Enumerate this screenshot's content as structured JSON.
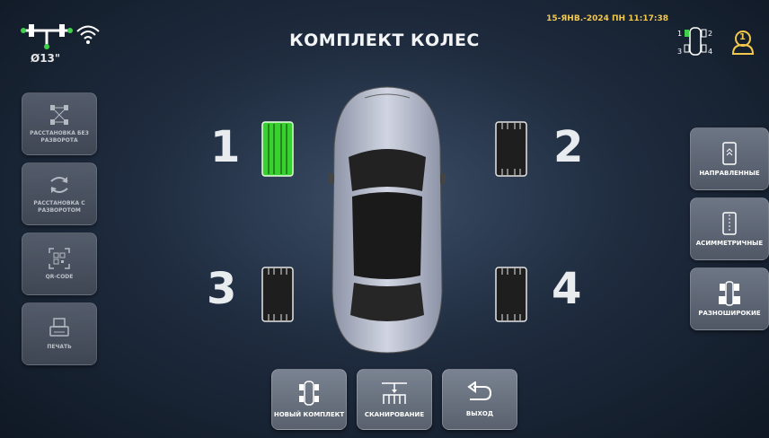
{
  "header": {
    "title": "КОМПЛЕКТ КОЛЕС",
    "datetime": "15-ЯНВ.-2024 ПН 11:17:38",
    "rim_size": "Ø13\"",
    "user_badge": "1",
    "wheel_positions": [
      "1",
      "2",
      "3",
      "4"
    ]
  },
  "left_menu": [
    {
      "label": "РАССТАНОВКА БЕЗ РАЗВОРОТА",
      "icon": "tire-swap-icon"
    },
    {
      "label": "РАССТАНОВКА С РАЗВОРОТОМ",
      "icon": "rotate-arrows-icon"
    },
    {
      "label": "QR-CODE",
      "icon": "qr-code-icon"
    },
    {
      "label": "ПЕЧАТЬ",
      "icon": "printer-icon"
    }
  ],
  "right_menu": [
    {
      "label": "НАПРАВЛЕННЫЕ",
      "icon": "directional-tire-icon"
    },
    {
      "label": "АСИММЕТРИЧНЫЕ",
      "icon": "asymmetric-tire-icon"
    },
    {
      "label": "РАЗНОШИРОКИЕ",
      "icon": "mixed-width-icon"
    }
  ],
  "bottom_menu": [
    {
      "label": "НОВЫЙ КОМПЛЕКТ",
      "icon": "car-top-icon"
    },
    {
      "label": "СКАНИРОВАНИЕ",
      "icon": "scan-icon"
    },
    {
      "label": "ВЫХОД",
      "icon": "back-arrow-icon"
    }
  ],
  "wheels": [
    {
      "position": "1",
      "active": true
    },
    {
      "position": "2",
      "active": false
    },
    {
      "position": "3",
      "active": false
    },
    {
      "position": "4",
      "active": false
    }
  ],
  "colors": {
    "active_tire": "#39d12f",
    "inactive_tire": "#1e1e1e",
    "datetime": "#f2c94c",
    "wifi_connected": "#ffffff",
    "axle_indicator": "#3fd14a"
  }
}
